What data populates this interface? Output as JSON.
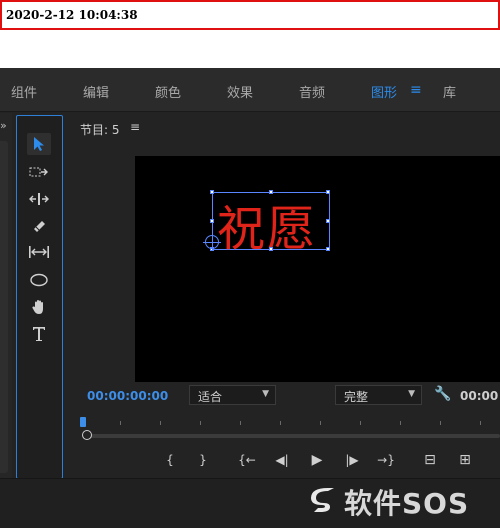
{
  "timestamp": "2020-2-12 10:04:38",
  "workspace_tabs": [
    {
      "label": "组件"
    },
    {
      "label": "编辑"
    },
    {
      "label": "颜色"
    },
    {
      "label": "效果"
    },
    {
      "label": "音频"
    },
    {
      "label": "图形",
      "active": true
    },
    {
      "label": "库"
    }
  ],
  "tab_menu_icon": "≡",
  "left_panel": {
    "chevron": "»"
  },
  "tools": [
    {
      "name": "selection-tool-icon",
      "selected": true
    },
    {
      "name": "track-select-tool-icon"
    },
    {
      "name": "ripple-edit-tool-icon"
    },
    {
      "name": "razor-tool-icon"
    },
    {
      "name": "slip-tool-icon"
    },
    {
      "name": "ellipse-tool-icon"
    },
    {
      "name": "hand-tool-icon"
    },
    {
      "name": "type-tool-icon"
    }
  ],
  "monitor": {
    "title": "节目: 5",
    "menu_icon": "≡",
    "text_content": "祝愿",
    "text_color": "#e0241a",
    "timecode": "00:00:00:00",
    "zoom_select": "适合",
    "quality_select": "完整",
    "timecode_right": "00:00"
  },
  "transport": {
    "mark_in": "{",
    "mark_out": "}",
    "go_to_in": "{←",
    "step_back": "◀|",
    "play": "▶",
    "step_forward": "|▶",
    "go_to_out": "→}",
    "lift": "⊟",
    "extract": "⊞"
  },
  "watermark": "软件SOS",
  "colors": {
    "accent": "#2d8ceb",
    "highlight_border": "#e01010",
    "panel": "#232323"
  }
}
